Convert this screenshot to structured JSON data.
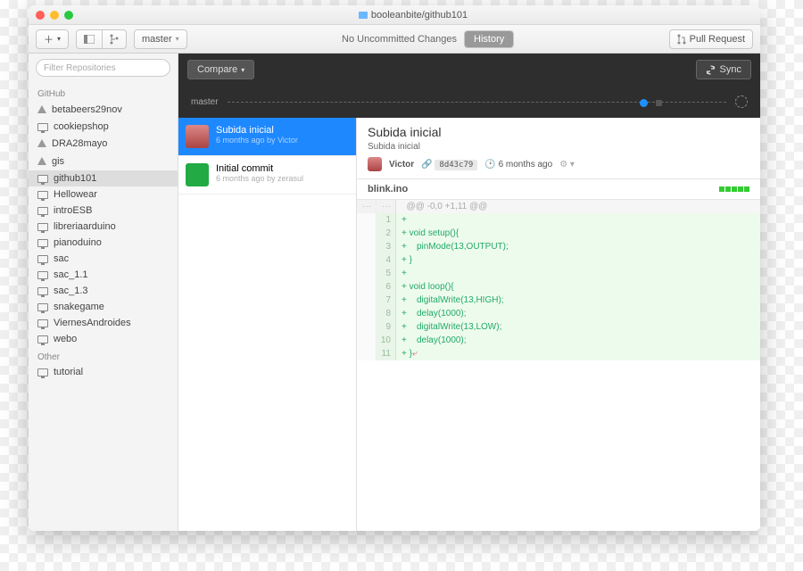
{
  "title": "booleanbite/github101",
  "toolbar": {
    "master": "master",
    "status": "No Uncommitted Changes",
    "history": "History",
    "pull": "Pull Request"
  },
  "sidebar": {
    "filter_ph": "Filter Repositories",
    "heads": [
      "GitHub",
      "Other"
    ],
    "github": [
      {
        "icon": "warn",
        "label": "betabeers29nov"
      },
      {
        "icon": "mon",
        "label": "cookiepshop"
      },
      {
        "icon": "warn",
        "label": "DRA28mayo"
      },
      {
        "icon": "warn",
        "label": "gis"
      },
      {
        "icon": "mon",
        "label": "github101",
        "sel": true
      },
      {
        "icon": "mon",
        "label": "Hellowear"
      },
      {
        "icon": "mon",
        "label": "introESB"
      },
      {
        "icon": "mon",
        "label": "libreriaarduino"
      },
      {
        "icon": "mon",
        "label": "pianoduino"
      },
      {
        "icon": "mon",
        "label": "sac"
      },
      {
        "icon": "mon",
        "label": "sac_1.1"
      },
      {
        "icon": "mon",
        "label": "sac_1.3"
      },
      {
        "icon": "mon",
        "label": "snakegame"
      },
      {
        "icon": "mon",
        "label": "ViernesAndroides"
      },
      {
        "icon": "mon",
        "label": "webo"
      }
    ],
    "other": [
      {
        "icon": "mon",
        "label": "tutorial"
      }
    ]
  },
  "dark": {
    "compare": "Compare",
    "sync": "Sync",
    "branch": "master"
  },
  "commits": [
    {
      "title": "Subida inicial",
      "sub": "6 months ago by Victor",
      "sel": true,
      "av": "va"
    },
    {
      "title": "Initial commit",
      "sub": "6 months ago by zerasul",
      "sel": false,
      "av": "zb"
    }
  ],
  "detail": {
    "title": "Subida inicial",
    "sub": "Subida inicial",
    "author": "Victor",
    "sha": "8d43c79",
    "time": "6 months ago",
    "file": "blink.ino",
    "hunk": "@@ -0,0 +1,11 @@",
    "lines": [
      {
        "n": "1",
        "t": "+"
      },
      {
        "n": "2",
        "t": "+ void setup(){"
      },
      {
        "n": "3",
        "t": "+    pinMode(13,OUTPUT);"
      },
      {
        "n": "4",
        "t": "+ }"
      },
      {
        "n": "5",
        "t": "+"
      },
      {
        "n": "6",
        "t": "+ void loop(){"
      },
      {
        "n": "7",
        "t": "+    digitalWrite(13,HIGH);"
      },
      {
        "n": "8",
        "t": "+    delay(1000);"
      },
      {
        "n": "9",
        "t": "+    digitalWrite(13,LOW);"
      },
      {
        "n": "10",
        "t": "+    delay(1000);"
      },
      {
        "n": "11",
        "t": "+ }",
        "nl": true
      }
    ]
  }
}
